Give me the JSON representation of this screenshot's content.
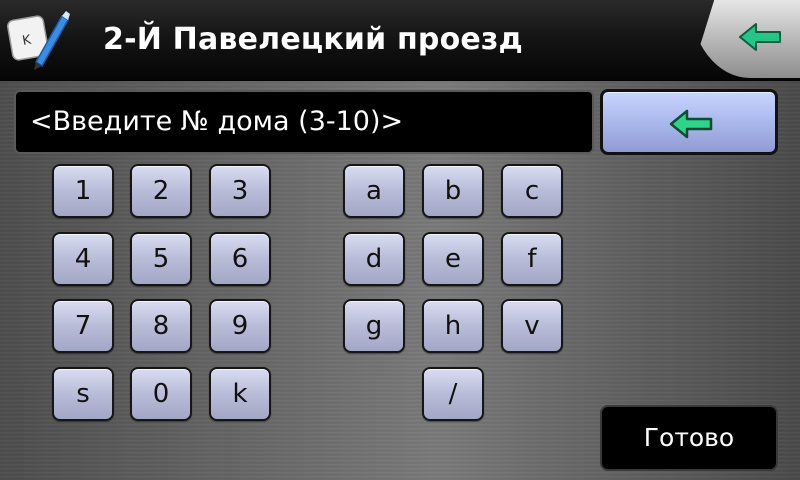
{
  "header": {
    "title": "2-Й Павелецкий проезд",
    "app_icon_letter": "K",
    "back_icon": "back-arrow-icon"
  },
  "input": {
    "placeholder": "<Введите № дома (3-10)>"
  },
  "backspace": {
    "icon": "backspace-arrow-icon"
  },
  "keypad": {
    "keys": [
      {
        "label": "1"
      },
      {
        "label": "2"
      },
      {
        "label": "3"
      },
      {
        "label": "4"
      },
      {
        "label": "5"
      },
      {
        "label": "6"
      },
      {
        "label": "7"
      },
      {
        "label": "8"
      },
      {
        "label": "9"
      },
      {
        "label": "s"
      },
      {
        "label": "0"
      },
      {
        "label": "k"
      },
      {
        "label": "a"
      },
      {
        "label": "b"
      },
      {
        "label": "c"
      },
      {
        "label": "d"
      },
      {
        "label": "e"
      },
      {
        "label": "f"
      },
      {
        "label": "g"
      },
      {
        "label": "h"
      },
      {
        "label": "v"
      },
      {
        "label": "/"
      }
    ]
  },
  "done_label": "Готово",
  "colors": {
    "arrow_green": "#2fd38a",
    "key_blue": "#b8bcd8"
  }
}
